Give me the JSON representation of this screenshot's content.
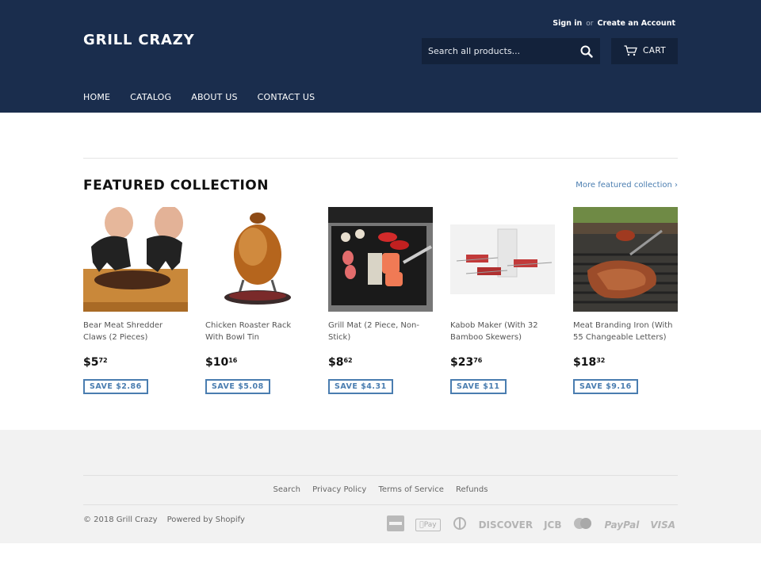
{
  "header": {
    "logo": "GRILL CRAZY",
    "sign_in": "Sign in",
    "or": "or",
    "create_account": "Create an Account",
    "search_placeholder": "Search all products...",
    "cart_label": "CART",
    "nav": [
      "HOME",
      "CATALOG",
      "ABOUT US",
      "CONTACT US"
    ]
  },
  "featured": {
    "title": "FEATURED COLLECTION",
    "more_link": "More featured collection ›"
  },
  "products": [
    {
      "name": "Bear Meat Shredder Claws (2 Pieces)",
      "price_whole": "$5",
      "price_cents": "72",
      "save": "SAVE $2.86"
    },
    {
      "name": "Chicken Roaster Rack With Bowl Tin",
      "price_whole": "$10",
      "price_cents": "16",
      "save": "SAVE $5.08"
    },
    {
      "name": "Grill Mat (2 Piece, Non-Stick)",
      "price_whole": "$8",
      "price_cents": "62",
      "save": "SAVE $4.31"
    },
    {
      "name": "Kabob Maker (With 32 Bamboo Skewers)",
      "price_whole": "$23",
      "price_cents": "76",
      "save": "SAVE $11"
    },
    {
      "name": "Meat Branding Iron (With 55 Changeable Letters)",
      "price_whole": "$18",
      "price_cents": "32",
      "save": "SAVE $9.16"
    }
  ],
  "footer": {
    "links": [
      "Search",
      "Privacy Policy",
      "Terms of Service",
      "Refunds"
    ],
    "copyright": "© 2018 Grill Crazy",
    "powered": "Powered by Shopify",
    "payment_icons": [
      "american-express-icon",
      "apple-pay-icon",
      "diners-club-icon",
      "discover-icon",
      "jcb-icon",
      "master-icon",
      "paypal-icon",
      "visa-icon"
    ],
    "payment_labels": {
      "apple_pay": "Pay",
      "discover": "DISCOVER",
      "jcb": "JCB",
      "paypal": "PayPal",
      "visa": "VISA"
    }
  },
  "colors": {
    "header_bg": "#1a2d4d",
    "accent": "#4a7db0",
    "footer_bg": "#f2f2f2"
  }
}
